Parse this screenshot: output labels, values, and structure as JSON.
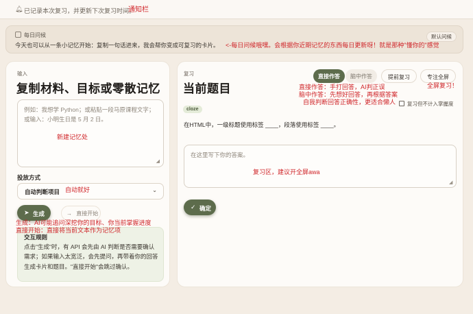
{
  "notice": {
    "text": "已记录本次复习，并更新下次复习时间。",
    "annotation": "通知栏"
  },
  "daily": {
    "title": "每日问候",
    "body": "今天也可以从一条小记忆开始：复制一句话进来，我会帮你变成可复习的卡片。",
    "tag": "默认问候",
    "annotation": "<-每日问候哦嘿。会根据你近期记忆的东西每日更新呀！就是那种\"懂你的\"感觉"
  },
  "left": {
    "eyebrow": "输入",
    "title": "复制材料、目标或零散记忆",
    "textarea_placeholder": "例如：我想学 Python；或粘贴一段马原课程文字；或输入：小明生日是 5 月 2 日。",
    "textarea_annotation": "新建记忆处",
    "mode_label": "投放方式",
    "mode_value": "自动判断项目",
    "mode_annotation": "自动就好",
    "generate_label": "生成",
    "direct_label": "直接开始",
    "annotation_generate": "生成：AI可能追问深挖你的目标、你当前掌握进度",
    "annotation_direct": "直接开始：直接将当前文本作为记忆项",
    "info_title": "交互规则",
    "info_body": "点击\"生成\"时，有 API 会先由 AI 判断是否需要确认需求；如果输入太宽泛，会先提问，再带着你的回答生成卡片和题目。\"直接开始\"会跳过确认。"
  },
  "right": {
    "eyebrow": "复习",
    "title": "当前题目",
    "tabs": [
      "直接作答",
      "脑中作答",
      "提前复习",
      "专注全屏"
    ],
    "annotation_direct": "直接作答：手打回答，AI判正误",
    "annotation_mental": "脑中作答：先想好回答，再根据答案",
    "annotation_self": "自我判断回答正确性，更适合懒人",
    "annotation_fullscreen": "全屏复习！",
    "chip": "cloze",
    "skip_label": "复习但不计入掌握度",
    "question": "在HTML中，一级标题使用标签 ____，段落使用标签 ____。",
    "answer_placeholder": "在这里写下你的答案。",
    "answer_annotation": "复习区，建议开全屏awa",
    "confirm_label": "确定"
  }
}
